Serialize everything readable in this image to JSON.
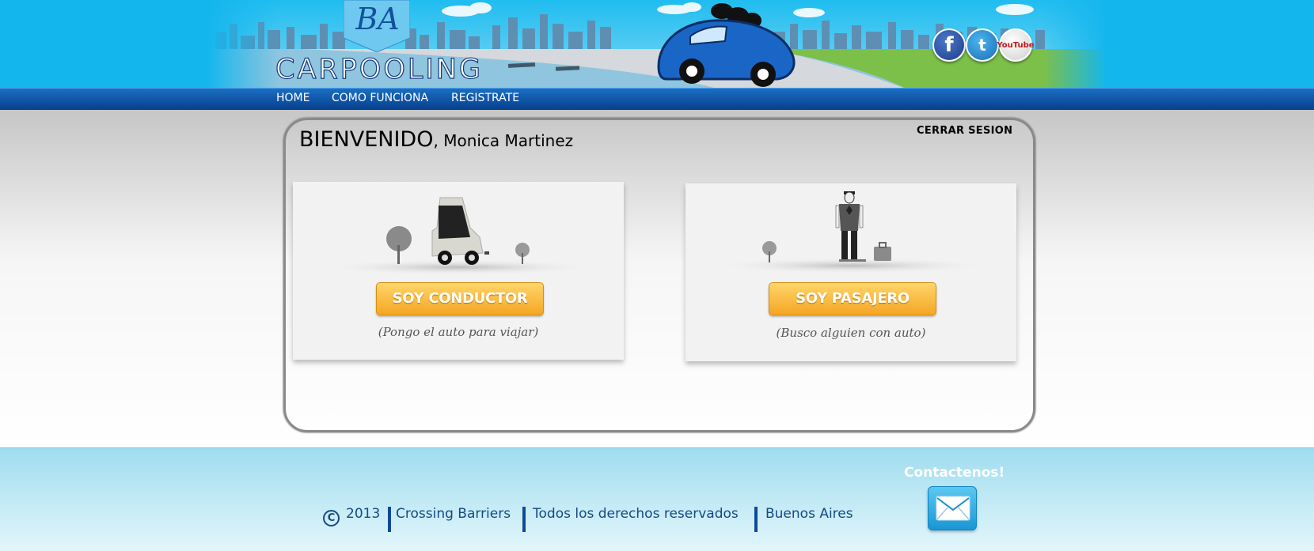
{
  "header": {
    "logo_initials": "BA",
    "logo_word": "CARPOOLING",
    "social": [
      {
        "name": "facebook",
        "label": "f"
      },
      {
        "name": "twitter",
        "label": "t"
      },
      {
        "name": "youtube",
        "label": "YouTube"
      }
    ]
  },
  "nav": {
    "items": [
      "HOME",
      "COMO FUNCIONA",
      "REGISTRATE"
    ]
  },
  "main": {
    "welcome_title": "BIENVENIDO",
    "welcome_name": ", Monica Martinez",
    "logout_label": "CERRAR SESION",
    "cards": [
      {
        "button": "SOY CONDUCTOR",
        "subtitle": "(Pongo el auto para viajar)"
      },
      {
        "button": "SOY PASAJERO",
        "subtitle": "(Busco alguien con auto)"
      }
    ]
  },
  "footer": {
    "copyright_symbol": "C",
    "year": "2013",
    "company": "Crossing Barriers",
    "rights": "Todos los derechos reservados",
    "city": "Buenos Aires",
    "contact_label": "Contactenos!"
  },
  "colors": {
    "header_sky": "#14b6ee",
    "nav_blue": "#073f8c",
    "button_orange": "#f5a623",
    "footer_blue": "#9fdcef",
    "text_blue": "#134a84"
  }
}
